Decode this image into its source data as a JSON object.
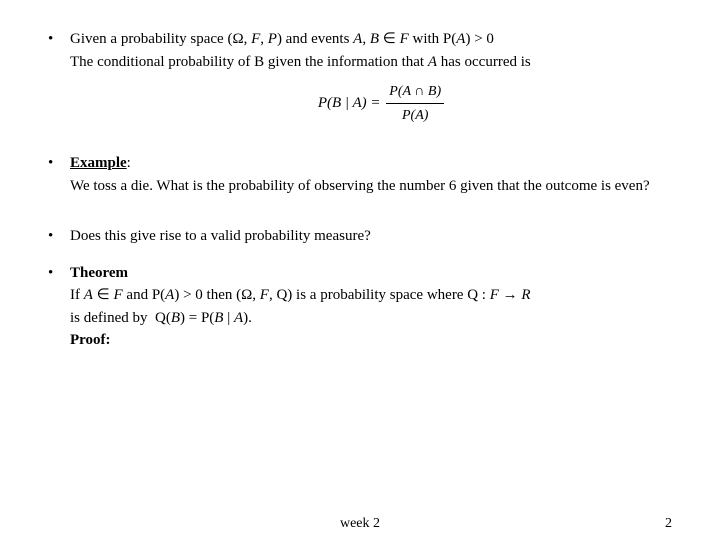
{
  "bullet1": {
    "intro": "Given a probability space (Ω, F, P) and events A, B ∈ F with P(A) > 0",
    "description": "The conditional probability of B given the information that A has occurred is"
  },
  "formula": {
    "label_left": "P(B | A) =",
    "numerator": "P(A ∩ B)",
    "denominator": "P(A)"
  },
  "bullet2": {
    "label": "Example:",
    "text": "We toss a die. What is the probability of observing the number 6 given that the outcome is even?"
  },
  "bullet3": {
    "text": "Does this give rise to a valid probability measure?"
  },
  "bullet4": {
    "label": "Theorem",
    "line1_pre": "If A ∈ F and P(A) > 0 then (Ω, F, Q) is a probability space where Q : F",
    "line1_arrow": "→",
    "line1_post": "R",
    "line2": "is defined by  Q(B) = P(B | A).",
    "proof": "Proof:"
  },
  "footer": {
    "center": "week 2",
    "page": "2"
  }
}
